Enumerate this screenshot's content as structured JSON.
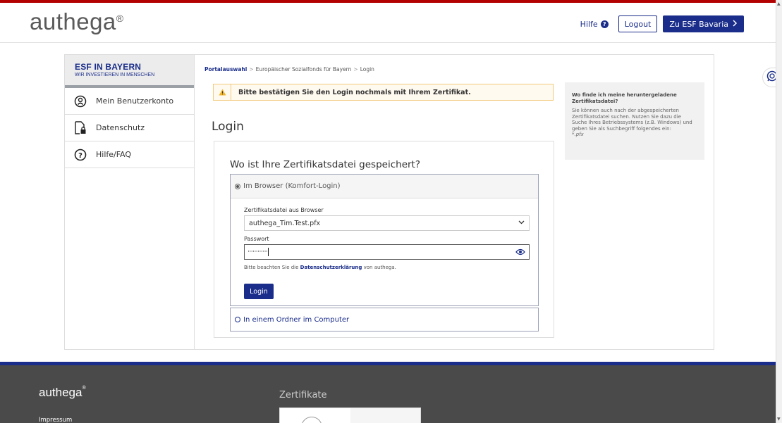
{
  "header": {
    "logo": "authega",
    "logo_reg": "®",
    "hilfe_label": "Hilfe",
    "logout_label": "Logout",
    "esf_button_label": "Zu ESF Bavaria"
  },
  "sidebar": {
    "title": "ESF IN BAYERN",
    "subtitle": "WIR INVESTIEREN IN MENSCHEN",
    "items": [
      {
        "label": "Mein Benutzerkonto",
        "icon": "user-circle-icon"
      },
      {
        "label": "Datenschutz",
        "icon": "document-lock-icon"
      },
      {
        "label": "Hilfe/FAQ",
        "icon": "question-circle-icon"
      }
    ]
  },
  "breadcrumb": {
    "items": [
      "Portalauswahl",
      "Europäischer Sozialfonds für Bayern",
      "Login"
    ],
    "separator": ">"
  },
  "alert": {
    "message": "Bitte bestätigen Sie den Login nochmals mit Ihrem Zertifikat."
  },
  "page_title": "Login",
  "login": {
    "question": "Wo ist Ihre Zertifikatsdatei gespeichert?",
    "option_browser": "Im Browser (Komfort-Login)",
    "cert_label": "Zertifikatsdatei aus Browser",
    "cert_value": "authega_Tim.Test.pfx",
    "password_label": "Passwort",
    "password_mask": "············",
    "note_prefix": "Bitte beachten Sie die",
    "note_link": "Datenschutzerklärung",
    "note_suffix": "von authega.",
    "login_button": "Login",
    "option_folder": "In einem Ordner im Computer"
  },
  "info": {
    "title": "Wo finde ich meine heruntergeladene Zertifikatsdatei?",
    "body": "Sie können auch nach der abgespeicherten Zertifikatsdatei suchen. Nutzen Sie dazu die Suche Ihres Betriebssystems (z.B. Windows) und geben Sie als Suchbegriff folgendes ein:",
    "term": "*.pfx"
  },
  "footer": {
    "logo": "authega",
    "logo_reg": "®",
    "impressum": "Impressum",
    "certificates_heading": "Zertifikate"
  },
  "colors": {
    "brand_blue": "#1a2d8a",
    "alert_border": "#f2c97a",
    "footer_bg": "#4a4a4a"
  }
}
